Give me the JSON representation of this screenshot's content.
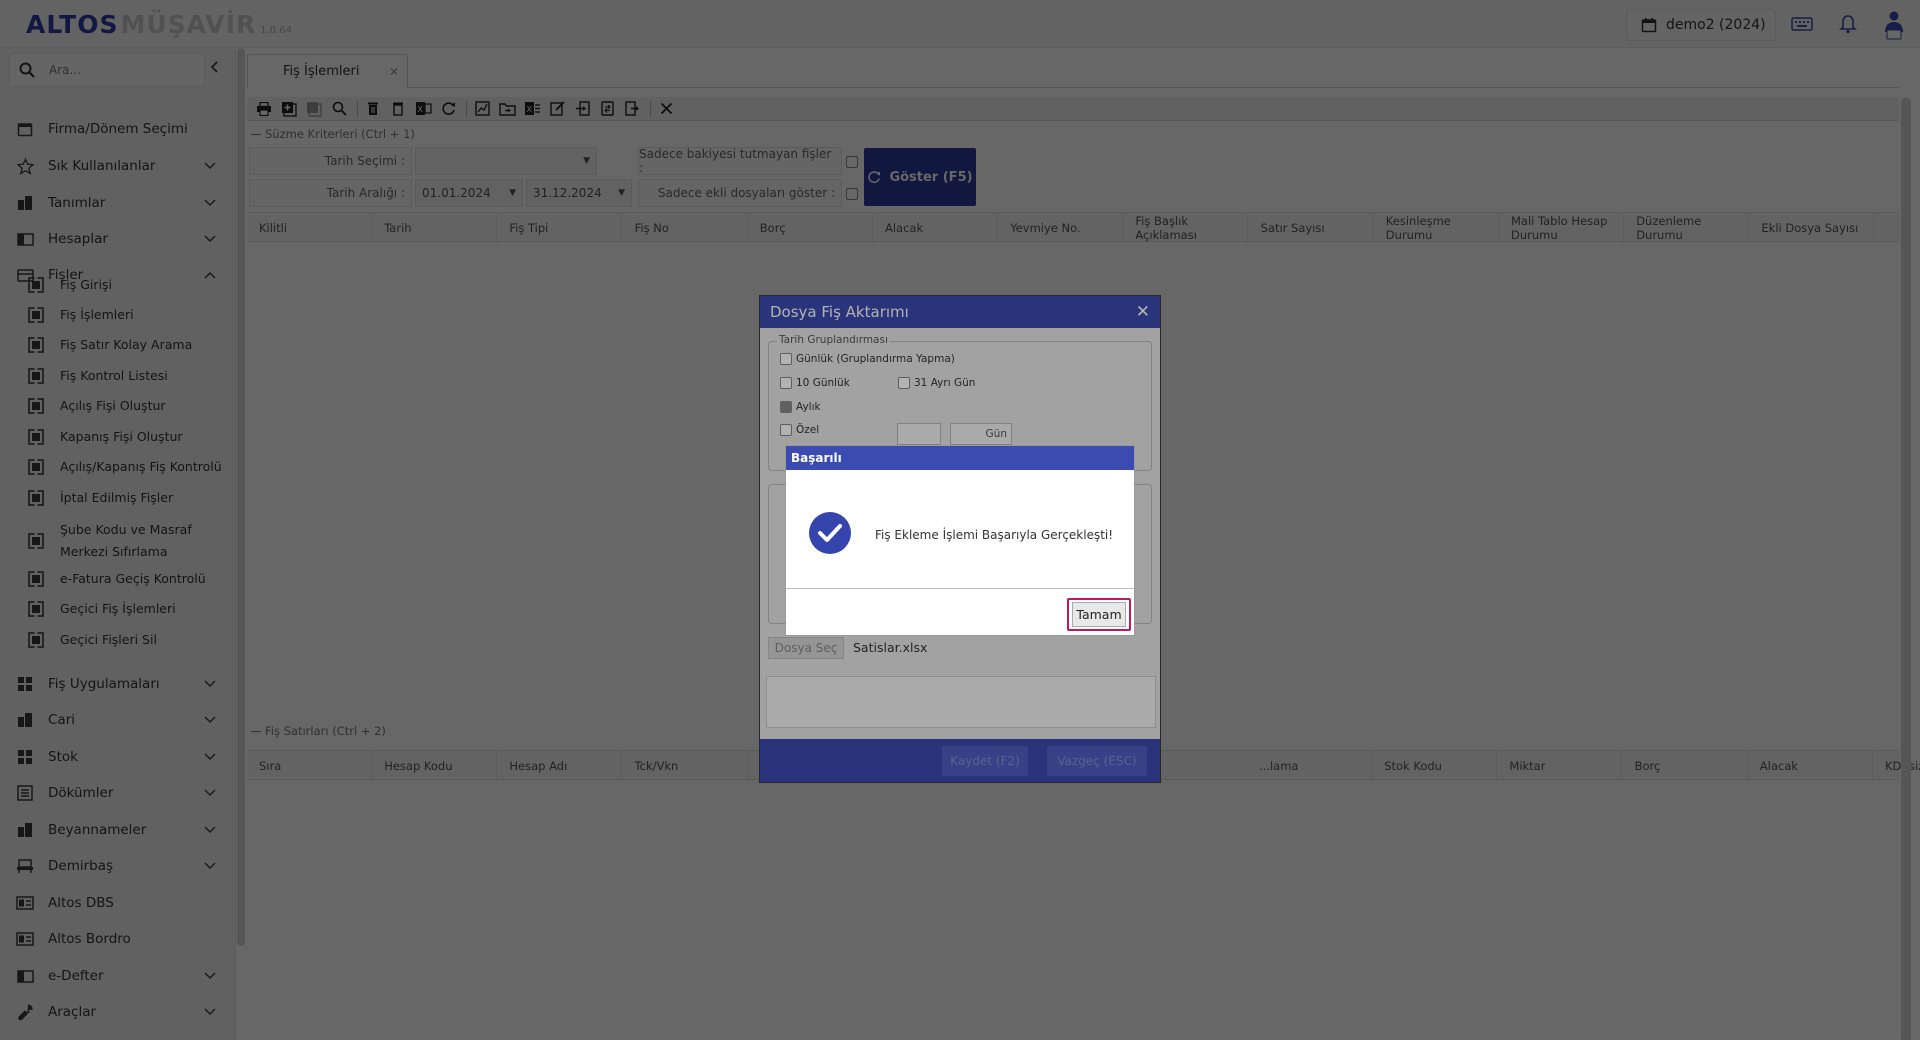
{
  "app": {
    "brand_part1": "ALTOS",
    "brand_part2": "MÜŞAVİR",
    "version": "1.0.64",
    "period": "demo2 (2024)",
    "accent_color": "#2c3da3"
  },
  "sidebar": {
    "search_placeholder": "Ara...",
    "items": [
      {
        "label": "Firma/Dönem Seçimi",
        "icon": "calendar-icon",
        "expandable": false
      },
      {
        "label": "Sık Kullanılanlar",
        "icon": "star-icon",
        "expandable": true
      },
      {
        "label": "Tanımlar",
        "icon": "building-icon",
        "expandable": true
      },
      {
        "label": "Hesaplar",
        "icon": "book-icon",
        "expandable": true
      },
      {
        "label": "Fişler",
        "icon": "receipt-icon",
        "expandable": true,
        "expanded": true
      },
      {
        "label": "Fiş Uygulamaları",
        "icon": "grid-icon",
        "expandable": true
      },
      {
        "label": "Cari",
        "icon": "building-icon",
        "expandable": true
      },
      {
        "label": "Stok",
        "icon": "grid-icon",
        "expandable": true
      },
      {
        "label": "Dökümler",
        "icon": "list-icon",
        "expandable": true
      },
      {
        "label": "Beyannameler",
        "icon": "building-icon",
        "expandable": true
      },
      {
        "label": "Demirbaş",
        "icon": "chair-icon",
        "expandable": true
      },
      {
        "label": "Altos DBS",
        "icon": "id-card-icon",
        "expandable": false
      },
      {
        "label": "Altos Bordro",
        "icon": "id-card-icon",
        "expandable": false
      },
      {
        "label": "e-Defter",
        "icon": "book-icon",
        "expandable": true
      },
      {
        "label": "Araçlar",
        "icon": "wrench-icon",
        "expandable": true
      }
    ],
    "fisler_sub": [
      "Fiş Girişi",
      "Fiş İşlemleri",
      "Fiş Satır Kolay Arama",
      "Fiş Kontrol Listesi",
      "Açılış Fişi Oluştur",
      "Kapanış Fişi Oluştur",
      "Açılış/Kapanış Fiş Kontrolü",
      "İptal Edilmiş Fişler",
      "Şube Kodu ve Masraf Merkezi Sıfırlama",
      "e-Fatura Geçiş Kontrolü",
      "Geçici Fiş İşlemleri",
      "Geçici Fişleri Sil"
    ]
  },
  "main": {
    "tab_label": "Fiş İşlemleri",
    "filter_section": "Süzme Kriterleri (Ctrl + 1)",
    "tarih_secimi_label": "Tarih Seçimi :",
    "tarih_secimi_value": "",
    "tarih_araligi_label": "Tarih Aralığı :",
    "date_from": "01.01.2024",
    "date_to": "31.12.2024",
    "opt_unbalanced": "Sadece bakiyesi tutmayan fişler :",
    "opt_attached": "Sadece ekli dosyaları göster :",
    "show_button": "Göster (F5)",
    "grid_columns": [
      "Kilitli",
      "Tarih",
      "Fiş Tipi",
      "Fiş No",
      "Borç",
      "Alacak",
      "Yevmiye No.",
      "Fiş Başlık Açıklaması",
      "Satır Sayısı",
      "Kesinleşme Durumu",
      "Mali Tablo Hesap Durumu",
      "Düzenleme Durumu",
      "Ekli Dosya Sayısı"
    ],
    "lines_section": "Fiş Satırları (Ctrl + 2)",
    "lines_columns_left": [
      "Sıra",
      "Hesap Kodu",
      "Hesap Adı",
      "Tck/Vkn"
    ],
    "lines_columns_right": [
      "...lama",
      "Stok Kodu",
      "Miktar",
      "Borç",
      "Alacak",
      "KDVsiz Tutar"
    ]
  },
  "import_dialog": {
    "title": "Dosya Fiş Aktarımı",
    "group_legend": "Tarih Gruplandırması",
    "opt_daily": "Günlük (Gruplandırma Yapma)",
    "opt_10day": "10 Günlük",
    "opt_31day": "31 Ayrı Gün",
    "opt_monthly": "Aylık",
    "opt_custom": "Özel",
    "day_unit": "Gün",
    "file_button": "Dosya Seç",
    "file_name": "Satislar.xlsx",
    "ok_button": "Kaydet (F2)",
    "close_button": "Vazgeç (ESC)"
  },
  "success_dialog": {
    "title": "Başarılı",
    "message": "Fiş Ekleme İşlemi Başarıyla Gerçekleşti!",
    "ok_button": "Tamam",
    "highlight_color": "#c2185b"
  }
}
